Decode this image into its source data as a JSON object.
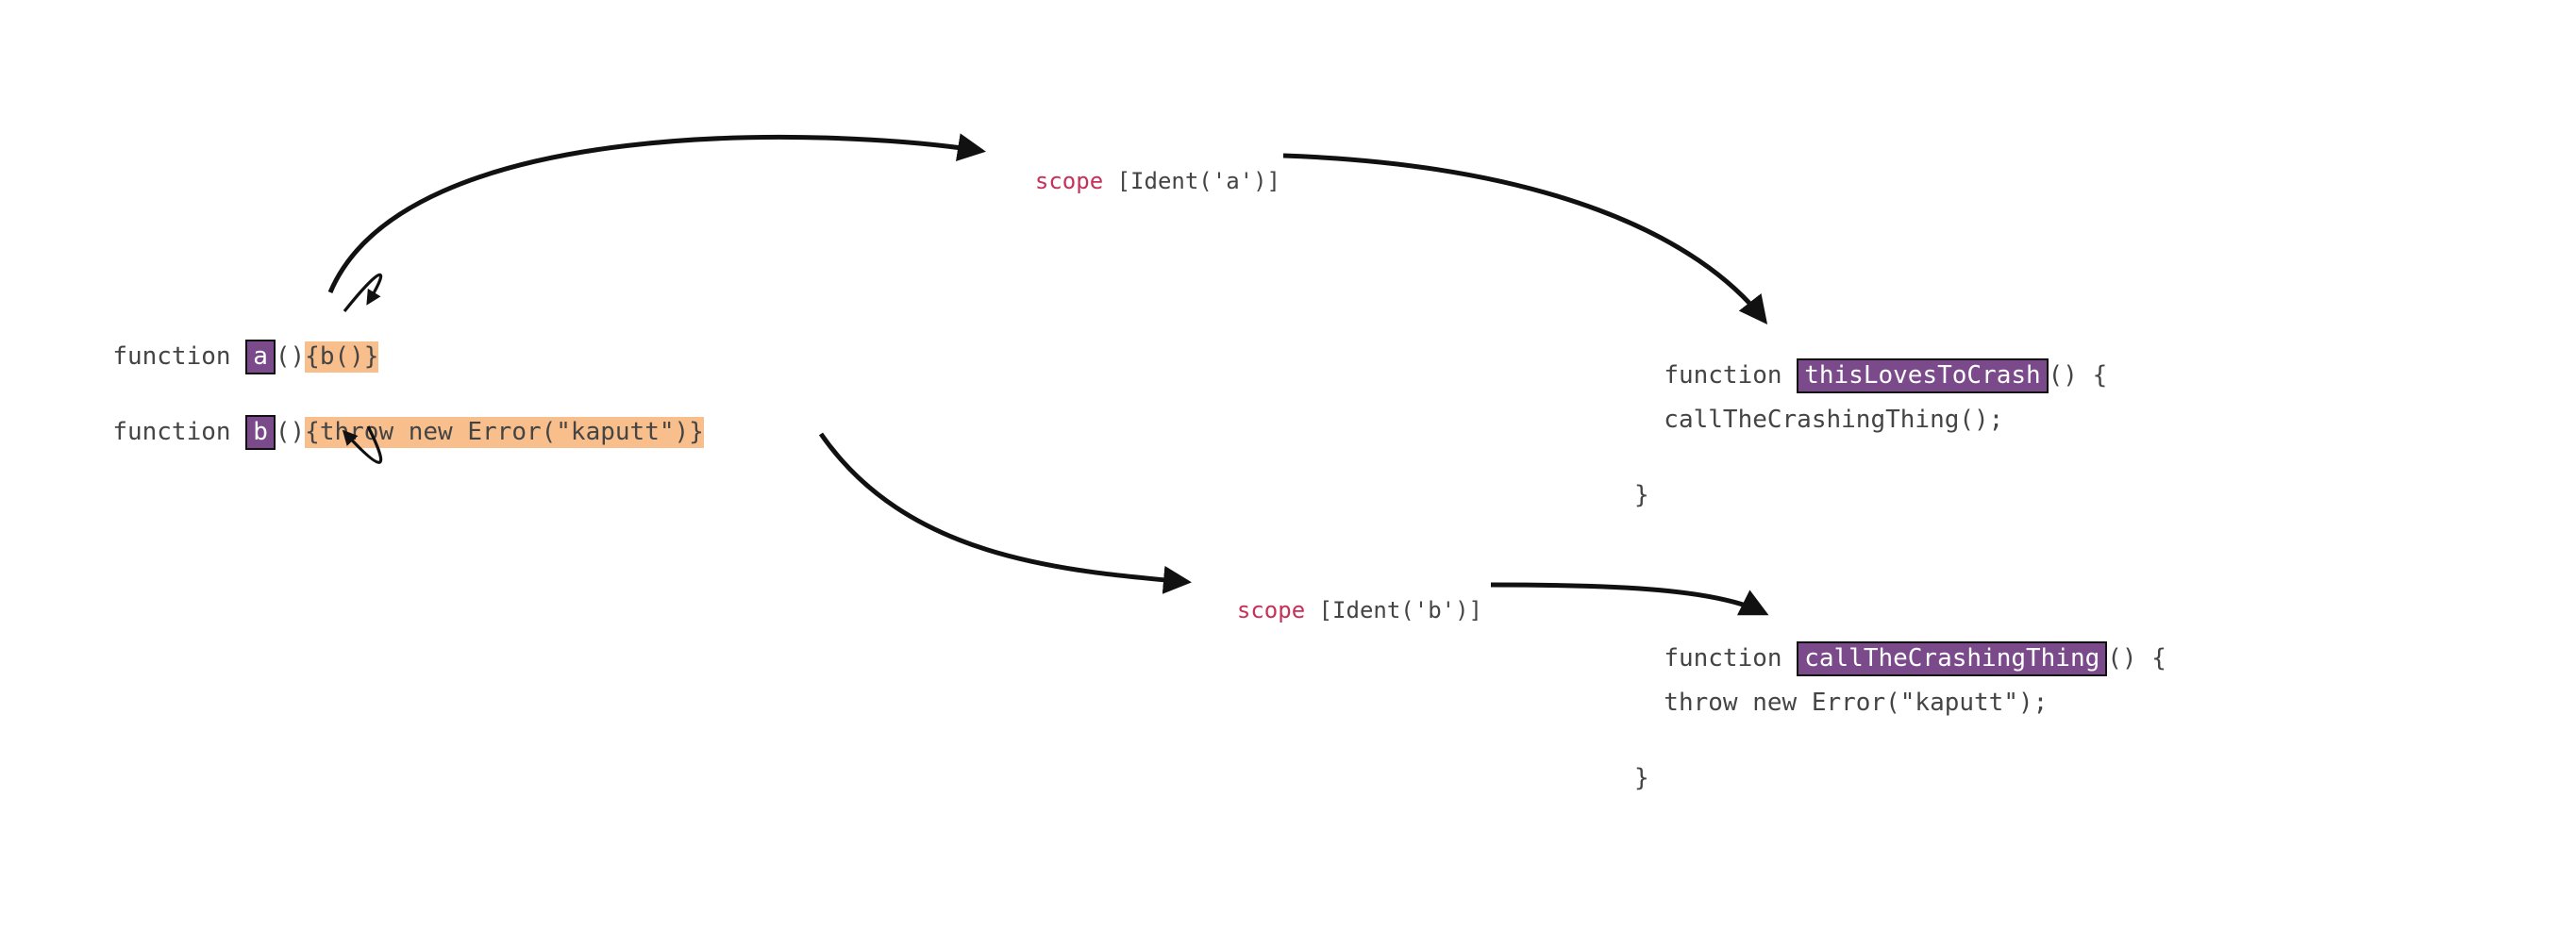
{
  "left": {
    "line1": {
      "prefix": "function ",
      "name": "a",
      "paren": "()",
      "body": "{b()}"
    },
    "line2": {
      "prefix": "function ",
      "name": "b",
      "paren": "()",
      "body": "{throw new Error(\"kaputt\")}"
    }
  },
  "scope_a": {
    "word": "scope",
    "rest": " [Ident('a')]"
  },
  "scope_b": {
    "word": "scope",
    "rest": " [Ident('b')]"
  },
  "right_a": {
    "prefix": "function ",
    "name": "thisLovesToCrash",
    "suffix": "() {",
    "body": "  callTheCrashingThing();",
    "close": "}"
  },
  "right_b": {
    "prefix": "function ",
    "name": "callTheCrashingThing",
    "suffix": "() {",
    "body": "  throw new Error(\"kaputt\");",
    "close": "}"
  }
}
